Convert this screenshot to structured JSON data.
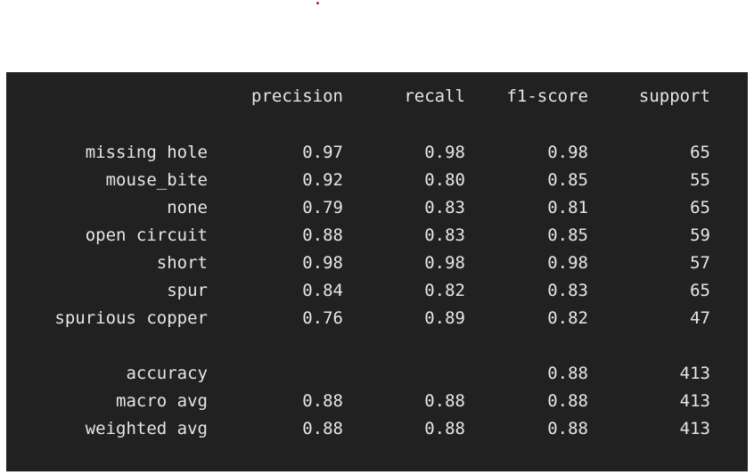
{
  "report": {
    "headers": {
      "precision": "precision",
      "recall": "recall",
      "f1": "f1-score",
      "support": "support"
    },
    "rows": [
      {
        "label": "missing hole",
        "precision": "0.97",
        "recall": "0.98",
        "f1": "0.98",
        "support": "65"
      },
      {
        "label": "mouse_bite",
        "precision": "0.92",
        "recall": "0.80",
        "f1": "0.85",
        "support": "55"
      },
      {
        "label": "none",
        "precision": "0.79",
        "recall": "0.83",
        "f1": "0.81",
        "support": "65"
      },
      {
        "label": "open circuit",
        "precision": "0.88",
        "recall": "0.83",
        "f1": "0.85",
        "support": "59"
      },
      {
        "label": "short",
        "precision": "0.98",
        "recall": "0.98",
        "f1": "0.98",
        "support": "57"
      },
      {
        "label": "spur",
        "precision": "0.84",
        "recall": "0.82",
        "f1": "0.83",
        "support": "65"
      },
      {
        "label": "spurious copper",
        "precision": "0.76",
        "recall": "0.89",
        "f1": "0.82",
        "support": "47"
      }
    ],
    "summary": [
      {
        "label": "accuracy",
        "precision": "",
        "recall": "",
        "f1": "0.88",
        "support": "413"
      },
      {
        "label": "macro avg",
        "precision": "0.88",
        "recall": "0.88",
        "f1": "0.88",
        "support": "413"
      },
      {
        "label": "weighted avg",
        "precision": "0.88",
        "recall": "0.88",
        "f1": "0.88",
        "support": "413"
      }
    ]
  },
  "colors": {
    "panel_background": "#212121",
    "text": "#e6e6e6",
    "dot": "#c2185b"
  }
}
